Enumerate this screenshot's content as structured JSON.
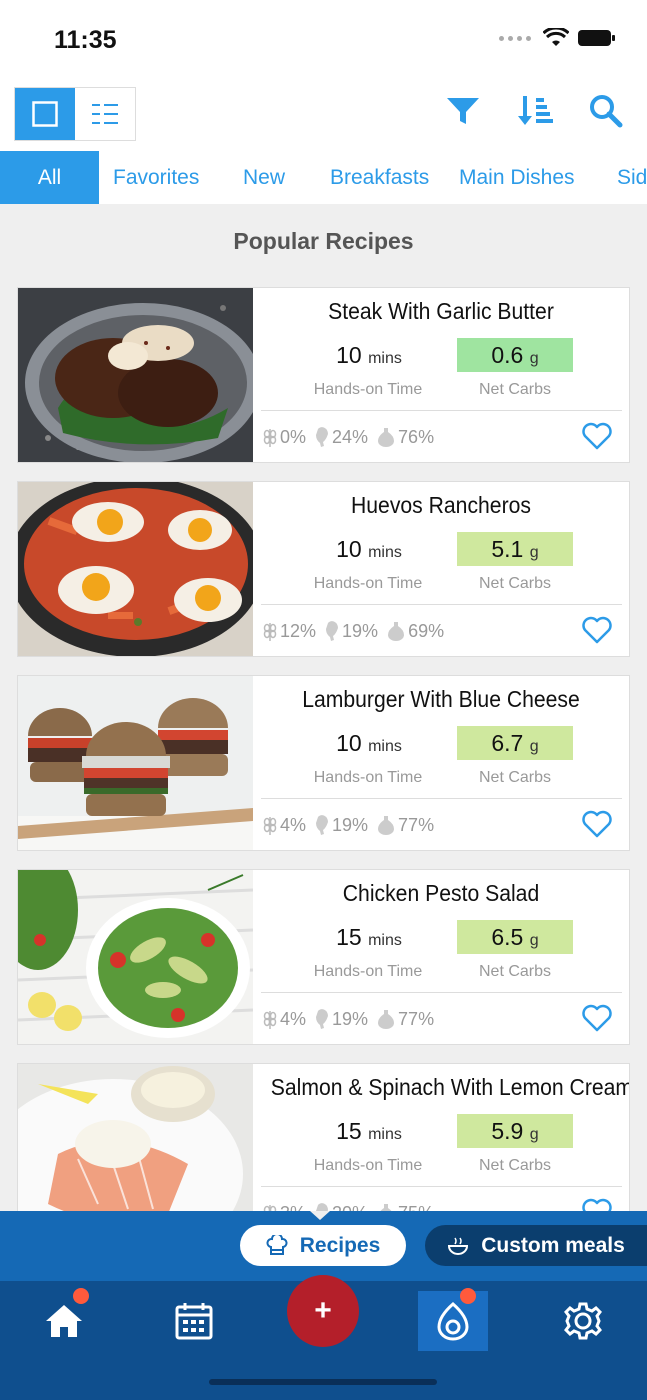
{
  "status": {
    "time": "11:35"
  },
  "tabs": [
    "All",
    "Favorites",
    "New",
    "Breakfasts",
    "Main Dishes",
    "Sid"
  ],
  "section_title": "Popular Recipes",
  "time_unit": "mins",
  "carb_unit": "g",
  "labels": {
    "time": "Hands-on Time",
    "carbs": "Net Carbs"
  },
  "recipes": [
    {
      "title": "Steak With Garlic Butter",
      "time": "10",
      "carbs": "0.6",
      "carb_color": "#9fe4a0",
      "macros": [
        "0%",
        "24%",
        "76%"
      ]
    },
    {
      "title": "Huevos Rancheros",
      "time": "10",
      "carbs": "5.1",
      "carb_color": "#cfe89e",
      "macros": [
        "12%",
        "19%",
        "69%"
      ]
    },
    {
      "title": "Lamburger With Blue Cheese",
      "time": "10",
      "carbs": "6.7",
      "carb_color": "#cfe89e",
      "macros": [
        "4%",
        "19%",
        "77%"
      ]
    },
    {
      "title": "Chicken Pesto Salad",
      "time": "15",
      "carbs": "6.5",
      "carb_color": "#cfe89e",
      "macros": [
        "4%",
        "19%",
        "77%"
      ]
    },
    {
      "title": "Salmon & Spinach With Lemon Cream",
      "time": "15",
      "carbs": "5.9",
      "carb_color": "#cfe89e",
      "macros": [
        "3%",
        "20%",
        "75%"
      ]
    }
  ],
  "mode_bar": {
    "recipes": "Recipes",
    "custom": "Custom meals"
  },
  "nav": {
    "add": "+"
  },
  "colors": {
    "accent": "#2c9be8",
    "nav": "#0f4f8e",
    "add": "#b41f2a"
  }
}
